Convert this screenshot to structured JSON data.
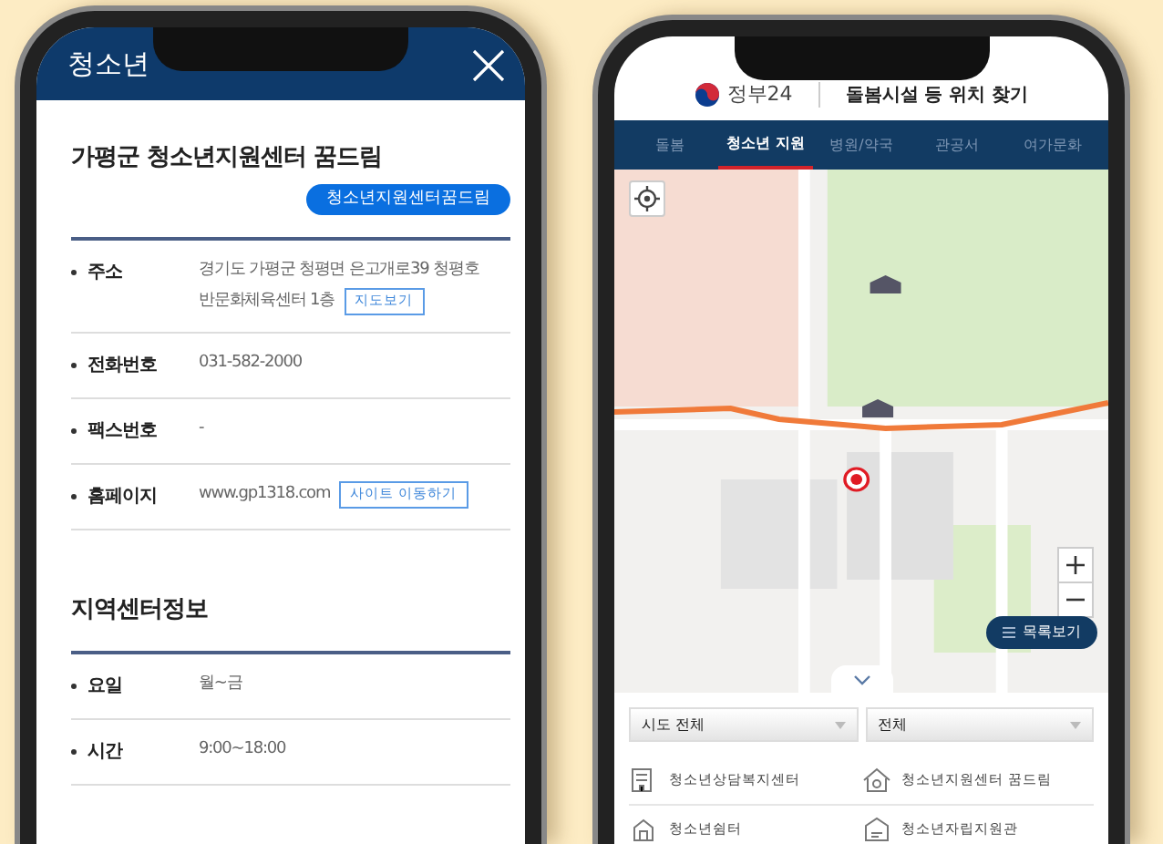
{
  "left_screen": {
    "header": {
      "title": "청소년"
    },
    "facility": {
      "name": "가평군 청소년지원센터 꿈드림",
      "tag": "청소년지원센터꿈드림"
    },
    "info_rows": [
      {
        "label": "주소",
        "value_lines": [
          "경기도 가평군 청평면 은고개로39 청평호",
          "반문화체육센터 1층"
        ],
        "action": "지도보기"
      },
      {
        "label": "전화번호",
        "value": "031-582-2000"
      },
      {
        "label": "팩스번호",
        "value": "-"
      },
      {
        "label": "홈페이지",
        "value": "www.gp1318.com",
        "action": "사이트 이동하기"
      }
    ],
    "section": {
      "title": "지역센터정보",
      "rows": [
        {
          "label": "요일",
          "value": "월~금"
        },
        {
          "label": "시간",
          "value": "9:00~18:00"
        }
      ]
    }
  },
  "right_screen": {
    "brand": "정부24",
    "title": "돌봄시설 등 위치 찾기",
    "tabs": [
      {
        "label": "돌봄",
        "selected": false
      },
      {
        "label": "청소년 지원",
        "selected": true
      },
      {
        "label": "병원/약국",
        "selected": false
      },
      {
        "label": "관공서",
        "selected": false
      },
      {
        "label": "여가문화",
        "selected": false
      }
    ],
    "map": {
      "list_button": "목록보기"
    },
    "filters": [
      {
        "value": "시도 전체"
      },
      {
        "value": "전체"
      }
    ],
    "categories": [
      {
        "label": "청소년상담복지센터"
      },
      {
        "label": "청소년지원센터 꿈드림"
      },
      {
        "label": "청소년쉼터"
      },
      {
        "label": "청소년자립지원관"
      }
    ]
  }
}
